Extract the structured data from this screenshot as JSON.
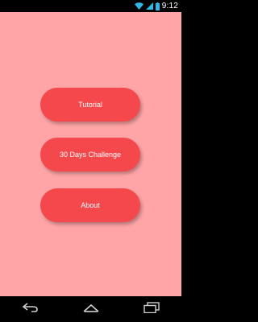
{
  "status_bar": {
    "time": "9:12",
    "icons": [
      "wifi-icon",
      "signal-icon",
      "battery-icon"
    ]
  },
  "app": {
    "background_color": "#ffa5a7",
    "button_color": "#f5484d"
  },
  "menu": {
    "tutorial_label": "Tutorial",
    "challenge_label": "30 Days Challenge",
    "about_label": "About"
  },
  "nav_bar": {
    "icons": [
      "back-icon",
      "home-icon",
      "recent-apps-icon"
    ]
  }
}
